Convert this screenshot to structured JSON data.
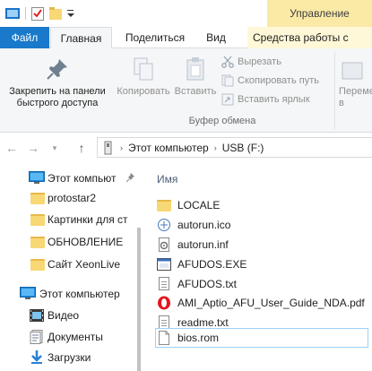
{
  "window": {
    "manage_tab": "Управление"
  },
  "tabs": {
    "file": "Файл",
    "home": "Главная",
    "share": "Поделиться",
    "view": "Вид",
    "drive_tools": "Средства работы с диска"
  },
  "ribbon": {
    "pin_line1": "Закрепить на панели",
    "pin_line2": "быстрого доступа",
    "copy": "Копировать",
    "paste": "Вставить",
    "cut": "Вырезать",
    "copy_path": "Скопировать путь",
    "paste_shortcut": "Вставить ярлык",
    "clipboard_group": "Буфер обмена",
    "move_line1": "Переме",
    "move_line2": "в"
  },
  "address": {
    "this_pc": "Этот компьютер",
    "drive": "USB (F:)"
  },
  "nav": {
    "items": [
      {
        "label": "Этот компьют",
        "icon": "monitor-icon",
        "pinned": true
      },
      {
        "label": "protostar2",
        "icon": "folder-icon"
      },
      {
        "label": "Картинки для ст",
        "icon": "folder-icon"
      },
      {
        "label": "ОБНОВЛЕНИЕ",
        "icon": "folder-icon"
      },
      {
        "label": "Сайт XeonLive",
        "icon": "folder-icon"
      },
      {
        "label": "Этот компьютер",
        "icon": "monitor-icon"
      },
      {
        "label": "Видео",
        "icon": "video-icon"
      },
      {
        "label": "Документы",
        "icon": "documents-icon"
      },
      {
        "label": "Загрузки",
        "icon": "downloads-icon"
      }
    ]
  },
  "content": {
    "column_name": "Имя",
    "files": [
      {
        "name": "LOCALE",
        "icon": "folder-icon"
      },
      {
        "name": "autorun.ico",
        "icon": "ico-file-icon"
      },
      {
        "name": "autorun.inf",
        "icon": "inf-file-icon"
      },
      {
        "name": "AFUDOS.EXE",
        "icon": "exe-file-icon"
      },
      {
        "name": "AFUDOS.txt",
        "icon": "txt-file-icon"
      },
      {
        "name": "AMI_Aptio_AFU_User_Guide_NDA.pdf",
        "icon": "pdf-file-icon"
      },
      {
        "name": "readme.txt",
        "icon": "txt-file-icon"
      },
      {
        "name": "bios.rom",
        "icon": "file-icon",
        "selected": true
      }
    ]
  },
  "colors": {
    "file_tab": "#1979ca",
    "manage_tab": "#fbe9a6",
    "folder": "#f8d775",
    "selection_border": "#99d1ff"
  }
}
